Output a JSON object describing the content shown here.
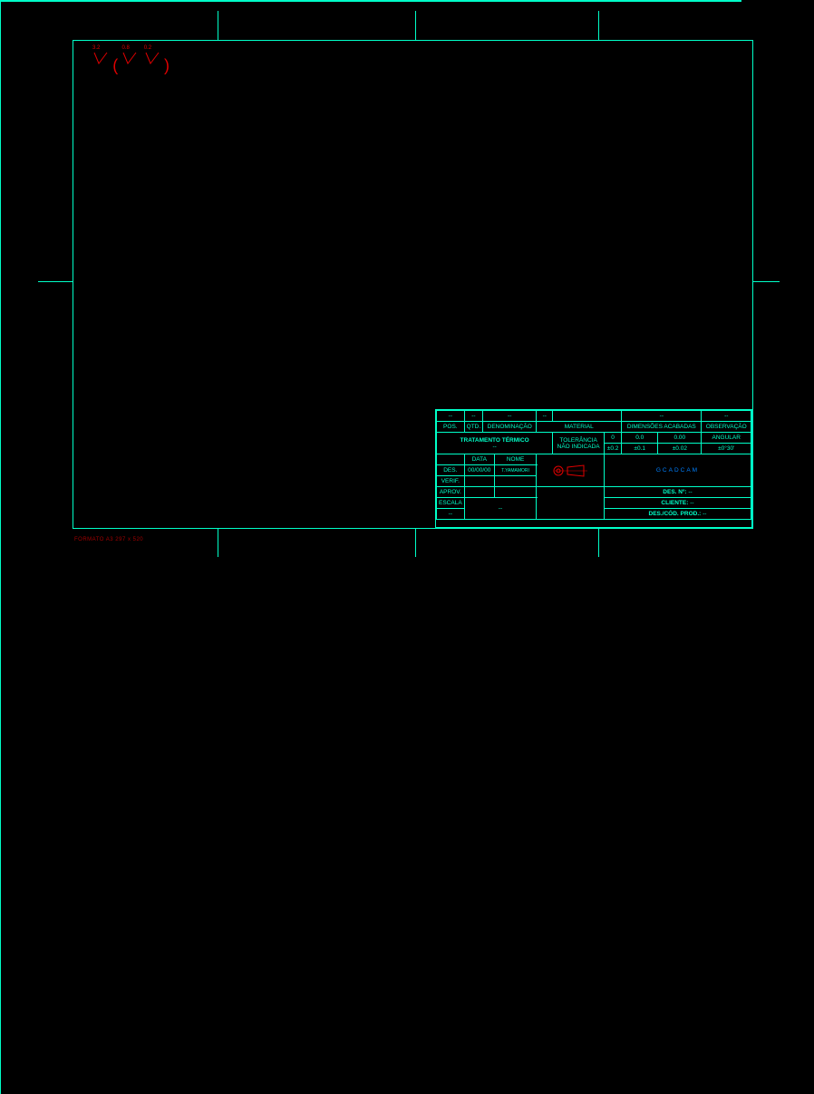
{
  "surface": {
    "v1": "3.2",
    "v2": "0.8",
    "v3": "0.2"
  },
  "parts_header": {
    "pos": "POS.",
    "qtd": "QTD.",
    "denom": "DENOMINAÇÃO",
    "material": "MATERIAL",
    "dims": "DIMENSÕES ACABADAS",
    "obs": "OBSERVAÇÃO"
  },
  "parts_row": {
    "pos": "--",
    "qtd": "--",
    "denom": "--",
    "material": "--",
    "dims": "--",
    "obs": "--"
  },
  "treat": {
    "label": "TRATAMENTO TÉRMICO",
    "value": "--"
  },
  "tol": {
    "label1": "TOLERÂNCIA",
    "label2": "NÃO INDICADA",
    "c0": "0",
    "c00": "0.0",
    "c000": "0.00",
    "cang": "ANGULAR",
    "v0": "±0.2",
    "v00": "±0.1",
    "v000": "±0.02",
    "vang": "±0°30'"
  },
  "sign": {
    "data": "DATA",
    "nome": "NOME",
    "des": "DES.",
    "des_data": "00/00/00",
    "des_nome": "T.YAMAMORI",
    "verif": "VERIF.",
    "aprov": "APROV.",
    "escala": "ESCALA",
    "escala_v": "--",
    "extra": "--"
  },
  "right": {
    "logo": "GCADCAM",
    "desno_l": "DES. Nº:",
    "desno_v": "--",
    "cliente_l": "CLIENTE:",
    "cliente_v": "--",
    "cod_l": "DES./CÓD. PROD.:",
    "cod_v": "--"
  },
  "format_note": "FORMATO A3  297 x 520"
}
